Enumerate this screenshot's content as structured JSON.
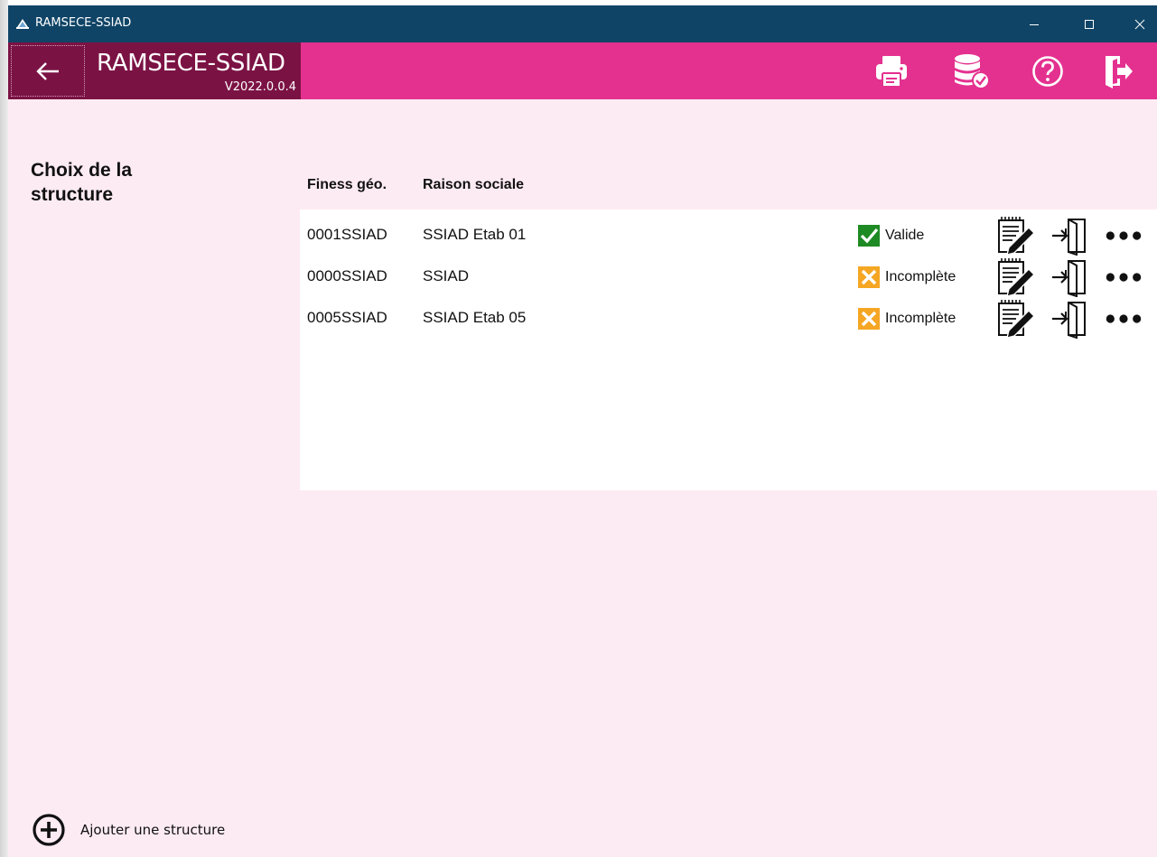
{
  "window": {
    "title": "RAMSECE-SSIAD",
    "titlebar_color": "#0f4466"
  },
  "header": {
    "app_name": "RAMSECE-SSIAD",
    "version": "V2022.0.0.4",
    "accent_color": "#e4318f",
    "brand_color": "#7b1244",
    "actions": [
      {
        "icon": "printer-icon"
      },
      {
        "icon": "database-check-icon"
      },
      {
        "icon": "help-icon"
      },
      {
        "icon": "exit-icon"
      }
    ]
  },
  "page": {
    "title": "Choix de la structure",
    "background": "#fdebf3"
  },
  "table": {
    "columns": [
      "Finess géo.",
      "Raison sociale"
    ],
    "rows": [
      {
        "finess": "0001SSIAD",
        "raison": "SSIAD Etab 01",
        "status": "Valide",
        "status_type": "valid"
      },
      {
        "finess": "0000SSIAD",
        "raison": "SSIAD",
        "status": "Incomplète",
        "status_type": "incomplete"
      },
      {
        "finess": "0005SSIAD",
        "raison": "SSIAD Etab 05",
        "status": "Incomplète",
        "status_type": "incomplete"
      }
    ],
    "status_colors": {
      "valid": "#1e8a24",
      "incomplete": "#f5a623"
    }
  },
  "footer": {
    "add_label": "Ajouter une structure"
  }
}
